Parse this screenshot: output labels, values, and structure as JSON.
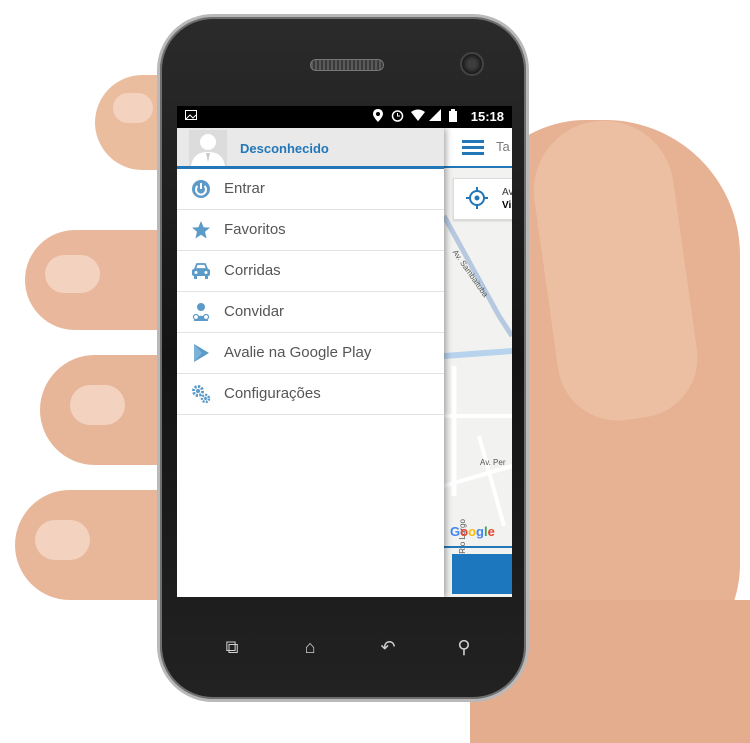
{
  "status_bar": {
    "time": "15:18",
    "icons": [
      "image-icon",
      "location-pin-icon",
      "alarm-icon",
      "wifi-icon",
      "signal-icon",
      "battery-icon"
    ]
  },
  "drawer": {
    "username": "Desconhecido",
    "items": [
      {
        "label": "Entrar",
        "icon": "power-icon"
      },
      {
        "label": "Favoritos",
        "icon": "star-icon"
      },
      {
        "label": "Corridas",
        "icon": "car-icon"
      },
      {
        "label": "Convidar",
        "icon": "invite-icon"
      },
      {
        "label": "Avalie na Google Play",
        "icon": "play-icon"
      },
      {
        "label": "Configurações",
        "icon": "gears-icon"
      }
    ]
  },
  "map": {
    "title_partial": "Ta",
    "address_line1": "Av",
    "address_line2": "Vi",
    "streets": [
      "Av. Sambaituba",
      "Av. Per",
      "R. Rio Largo"
    ],
    "logo": "Google"
  },
  "colors": {
    "accent": "#2277b8",
    "menu_icon": "#5b9ac9",
    "action_button": "#1d77bf"
  }
}
